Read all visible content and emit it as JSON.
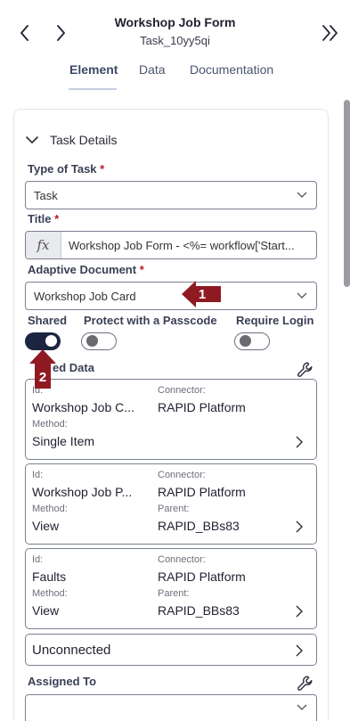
{
  "header": {
    "title": "Workshop Job Form",
    "subtitle": "Task_10yy5qi",
    "tabs": [
      {
        "label": "Element",
        "active": true
      },
      {
        "label": "Data",
        "active": false
      },
      {
        "label": "Documentation",
        "active": false
      }
    ]
  },
  "task_details": {
    "section_title": "Task Details",
    "type_of_task": {
      "label": "Type of Task",
      "required_mark": "*",
      "value": "Task"
    },
    "title_field": {
      "label": "Title",
      "required_mark": "*",
      "fx_label": "fx",
      "value": "Workshop Job Form - <%= workflow['Start..."
    },
    "adaptive_document": {
      "label": "Adaptive Document",
      "required_mark": "*",
      "value": "Workshop Job Card"
    },
    "toggles": [
      {
        "label": "Shared",
        "on": true
      },
      {
        "label": "Protect with a Passcode",
        "on": false
      },
      {
        "label": "Require Login",
        "on": false
      }
    ],
    "linked_data_label": "ed Data",
    "linked_cards": [
      {
        "id_key": "Id:",
        "id_value": "Workshop Job C...",
        "connector_key": "Connector:",
        "connector_value": "RAPID Platform",
        "method_key": "Method:",
        "method_value": "Single Item"
      },
      {
        "id_key": "Id:",
        "id_value": "Workshop Job P...",
        "connector_key": "Connector:",
        "connector_value": "RAPID Platform",
        "method_key": "Method:",
        "method_value": "View",
        "parent_key": "Parent:",
        "parent_value": "RAPID_BBs83"
      },
      {
        "id_key": "Id:",
        "id_value": "Faults",
        "connector_key": "Connector:",
        "connector_value": "RAPID Platform",
        "method_key": "Method:",
        "method_value": "View",
        "parent_key": "Parent:",
        "parent_value": "RAPID_BBs83"
      }
    ],
    "unconnected_label": "Unconnected",
    "assigned_to": {
      "label": "Assigned To",
      "value": ""
    }
  },
  "callouts": [
    "1",
    "2"
  ],
  "colors": {
    "accent_dark": "#1c2540",
    "required": "#c0172b",
    "callout": "#8f1a22"
  }
}
